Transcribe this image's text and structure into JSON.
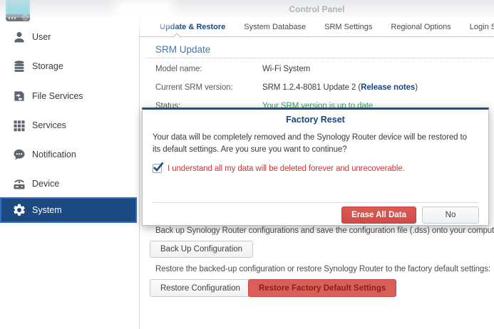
{
  "window": {
    "title": "Control Panel"
  },
  "sidebar": {
    "items": [
      {
        "label": "User",
        "icon": "user-icon"
      },
      {
        "label": "Storage",
        "icon": "storage-icon"
      },
      {
        "label": "File Services",
        "icon": "file-services-icon"
      },
      {
        "label": "Services",
        "icon": "services-icon"
      },
      {
        "label": "Notification",
        "icon": "notification-icon"
      },
      {
        "label": "Device",
        "icon": "device-icon"
      },
      {
        "label": "System",
        "icon": "gear-icon",
        "selected": true
      }
    ]
  },
  "tabs": [
    {
      "label": "Update & Restore",
      "active": true
    },
    {
      "label": "System Database",
      "active": false
    },
    {
      "label": "SRM Settings",
      "active": false
    },
    {
      "label": "Regional Options",
      "active": false
    },
    {
      "label": "Login Style",
      "active": false
    }
  ],
  "srm_update": {
    "heading": "SRM Update",
    "rows": [
      {
        "label": "Model name:",
        "value": "Wi-Fi System"
      },
      {
        "label": "Current SRM version:",
        "value_prefix": "SRM 1.2.4-8081 Update 2 (",
        "link": "Release notes",
        "value_suffix": ")"
      },
      {
        "label": "Status:",
        "value": "Your SRM version is up to date"
      }
    ]
  },
  "backup_section": {
    "backup_text": "Back up Synology Router configurations and save the configuration file (.dss) onto your computer.",
    "backup_button": "Back Up Configuration",
    "restore_text": "Restore the backed-up configuration or restore Synology Router to the factory default settings:",
    "restore_button": "Restore Configuration",
    "restore_factory_button": "Restore Factory Default Settings"
  },
  "modal": {
    "title": "Factory Reset",
    "body_line1": "Your data will be completely removed and the Synology Router device will be restored to",
    "body_line2": "its default settings. Are you sure you want to continue?",
    "checkbox_checked": true,
    "checkbox_label": "I understand all my data will be deleted forever and unrecoverable.",
    "erase_button": "Erase All Data",
    "no_button": "No"
  },
  "colors": {
    "accent_blue": "#17457e",
    "selected_item_bg": "#1a4a80",
    "selected_item_border": "#2f6fc2",
    "heading_blue": "#3f77b0",
    "danger_red": "#d5524d",
    "warning_text_red": "#c43a36",
    "status_green": "#3f9e5f",
    "app_icon_teal": "#4ecfda"
  }
}
